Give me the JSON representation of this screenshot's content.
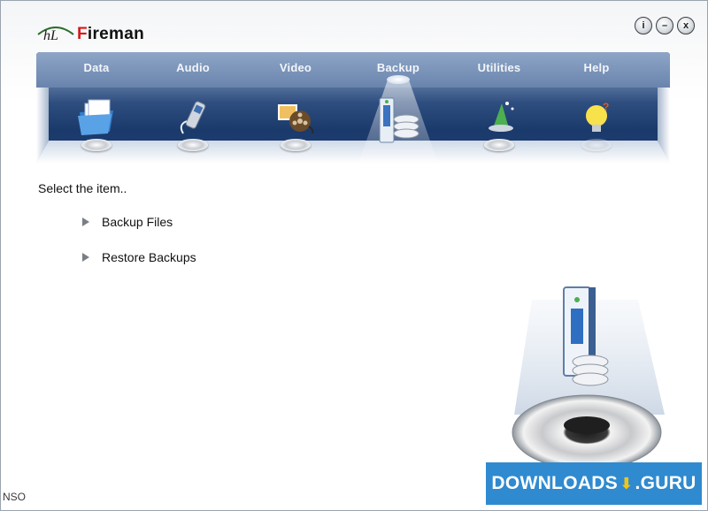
{
  "app": {
    "title": "Fireman",
    "title_first_letter": "F",
    "title_rest": "ireman",
    "logo_mark": "hL"
  },
  "window_buttons": [
    {
      "name": "info-button",
      "glyph": "i"
    },
    {
      "name": "minimize-button",
      "glyph": "–"
    },
    {
      "name": "close-button",
      "glyph": "x"
    }
  ],
  "nav": {
    "tabs": [
      {
        "label": "Data",
        "icon": "folder-documents-icon"
      },
      {
        "label": "Audio",
        "icon": "mp3-player-icon"
      },
      {
        "label": "Video",
        "icon": "film-reel-icon"
      },
      {
        "label": "Backup",
        "icon": "hard-drive-icon",
        "active": true
      },
      {
        "label": "Utilities",
        "icon": "magic-hat-icon"
      },
      {
        "label": "Help",
        "icon": "light-bulb-icon"
      }
    ]
  },
  "main": {
    "prompt": "Select the item..",
    "items": [
      {
        "label": "Backup Files"
      },
      {
        "label": "Restore Backups"
      }
    ]
  },
  "watermark": {
    "text_left": "DOWNLOADS",
    "text_right": ".GURU"
  },
  "corner_text": "NSO",
  "colors": {
    "accent_red": "#d21c1c",
    "nav_dark_blue": "#1b3a6c",
    "watermark_blue": "#2f8ad0"
  }
}
